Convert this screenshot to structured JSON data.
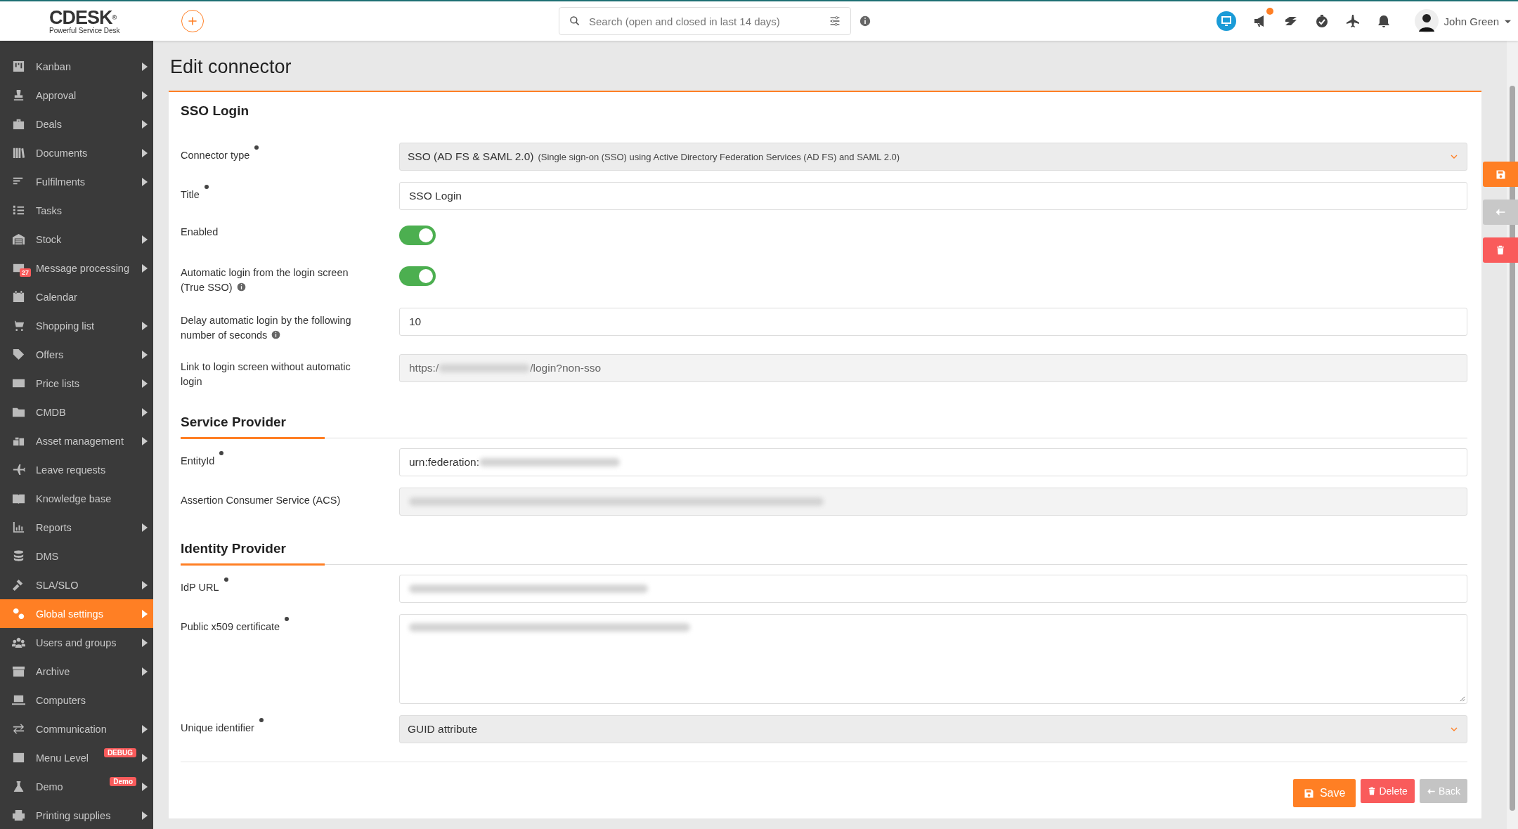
{
  "header": {
    "logo": "CDESK",
    "logo_mark": "®",
    "tagline": "Powerful Service Desk",
    "search": {
      "placeholder": "Search (open and closed in last 14 days)"
    },
    "announcements_unread": true,
    "user": {
      "name": "John Green"
    }
  },
  "sidebar": {
    "items": [
      {
        "label": "Kanban",
        "submenu": true,
        "selected": false
      },
      {
        "label": "Approval",
        "submenu": true,
        "selected": false
      },
      {
        "label": "Deals",
        "submenu": true,
        "selected": false
      },
      {
        "label": "Documents",
        "submenu": true,
        "selected": false
      },
      {
        "label": "Fulfilments",
        "submenu": true,
        "selected": false
      },
      {
        "label": "Tasks",
        "submenu": false,
        "selected": false
      },
      {
        "label": "Stock",
        "submenu": true,
        "selected": false
      },
      {
        "label": "Message processing",
        "submenu": true,
        "selected": false,
        "counter": "27"
      },
      {
        "label": "Calendar",
        "submenu": false,
        "selected": false
      },
      {
        "label": "Shopping list",
        "submenu": true,
        "selected": false
      },
      {
        "label": "Offers",
        "submenu": true,
        "selected": false
      },
      {
        "label": "Price lists",
        "submenu": true,
        "selected": false
      },
      {
        "label": "CMDB",
        "submenu": true,
        "selected": false
      },
      {
        "label": "Asset management",
        "submenu": true,
        "selected": false
      },
      {
        "label": "Leave requests",
        "submenu": false,
        "selected": false
      },
      {
        "label": "Knowledge base",
        "submenu": false,
        "selected": false
      },
      {
        "label": "Reports",
        "submenu": true,
        "selected": false
      },
      {
        "label": "DMS",
        "submenu": false,
        "selected": false
      },
      {
        "label": "SLA/SLO",
        "submenu": true,
        "selected": false
      },
      {
        "label": "Global settings",
        "submenu": true,
        "selected": true
      },
      {
        "label": "Users and groups",
        "submenu": true,
        "selected": false
      },
      {
        "label": "Archive",
        "submenu": true,
        "selected": false
      },
      {
        "label": "Computers",
        "submenu": false,
        "selected": false
      },
      {
        "label": "Communication",
        "submenu": true,
        "selected": false
      },
      {
        "label": "Menu Level",
        "submenu": true,
        "selected": false,
        "badge": "DEBUG"
      },
      {
        "label": "Demo",
        "submenu": true,
        "selected": false,
        "badge": "Demo"
      },
      {
        "label": "Printing supplies",
        "submenu": true,
        "selected": false
      }
    ]
  },
  "page": {
    "title": "Edit connector"
  },
  "form": {
    "sections": [
      {
        "title": "SSO Login",
        "kind": "plain",
        "fields": [
          {
            "label": "Connector type",
            "required": true,
            "kind": "select",
            "value": "SSO (AD FS & SAML 2.0)",
            "hint": "(Single sign-on (SSO) using Active Directory Federation Services (AD FS) and SAML 2.0)"
          },
          {
            "label": "Title",
            "required": true,
            "kind": "text",
            "value": "SSO Login"
          },
          {
            "label": "Enabled",
            "kind": "toggle",
            "on": true
          },
          {
            "label": "Automatic login from the login screen (True SSO)",
            "info": true,
            "kind": "toggle",
            "on": true
          },
          {
            "label": "Delay automatic login by the following number of seconds",
            "info": true,
            "kind": "text",
            "value": "10"
          },
          {
            "label": "Link to login screen without automatic login",
            "kind": "readonly",
            "value": "https:/",
            "redacted": true,
            "value_after": "/login?non-sso"
          }
        ]
      },
      {
        "title": "Service Provider",
        "kind": "ruled",
        "fields": [
          {
            "label": "EntityId",
            "required": true,
            "kind": "text",
            "value": "urn:federation:",
            "redacted": true
          },
          {
            "label": "Assertion Consumer Service (ACS)",
            "kind": "readonly",
            "redacted": true
          }
        ]
      },
      {
        "title": "Identity Provider",
        "kind": "ruled",
        "fields": [
          {
            "label": "IdP URL",
            "required": true,
            "kind": "text",
            "redacted": true
          },
          {
            "label": "Public x509 certificate",
            "required": true,
            "kind": "textarea",
            "redacted": true
          },
          {
            "label": "Unique identifier",
            "required": true,
            "kind": "select",
            "value": "GUID attribute"
          }
        ]
      }
    ],
    "actions": [
      {
        "label": "Save",
        "kind": "save"
      },
      {
        "label": "Delete",
        "kind": "delete"
      },
      {
        "label": "Back",
        "kind": "back"
      }
    ]
  },
  "side_actions": [
    {
      "kind": "save"
    },
    {
      "kind": "back"
    },
    {
      "kind": "delete"
    }
  ]
}
